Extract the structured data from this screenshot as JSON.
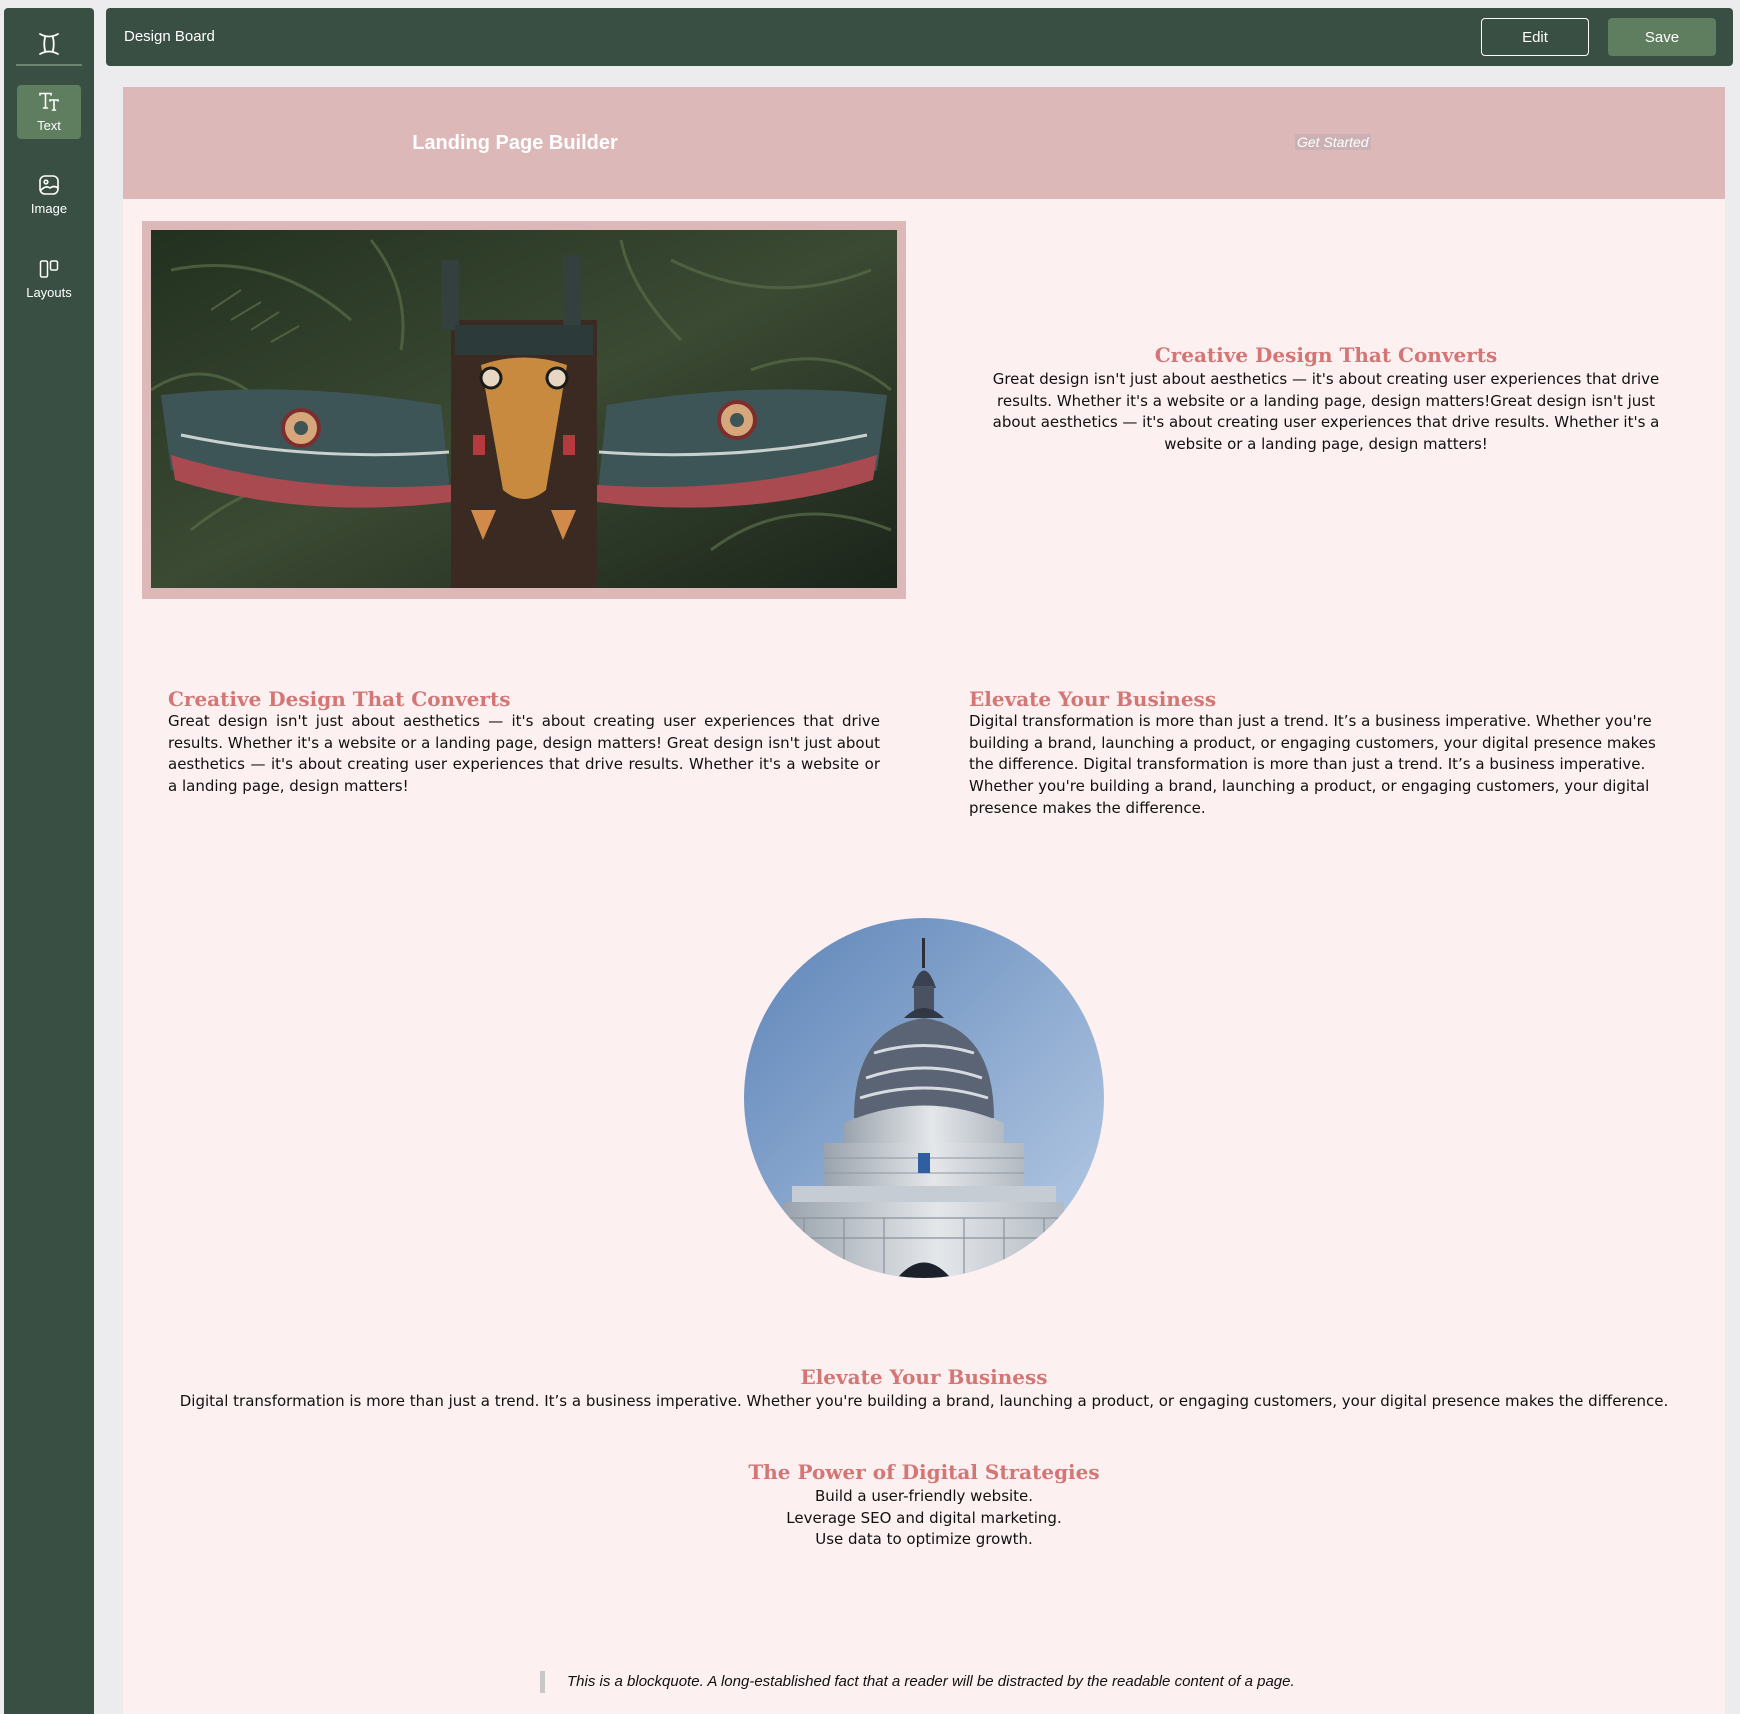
{
  "app": {
    "title": "Design Board"
  },
  "sidebar": {
    "logo_icon": "gemini-icon",
    "items": [
      {
        "label": "Text",
        "icon": "text-icon",
        "active": true
      },
      {
        "label": "Image",
        "icon": "image-icon",
        "active": false
      },
      {
        "label": "Layouts",
        "icon": "layouts-icon",
        "active": false
      }
    ]
  },
  "toolbar": {
    "edit_label": "Edit",
    "save_label": "Save"
  },
  "colors": {
    "sidebar": "#3a4f43",
    "accent_button": "#5f7d5f",
    "hero_bg": "#dcb8b8",
    "canvas_bg": "#fcf0f0",
    "heading": "#d47676"
  },
  "canvas": {
    "hero": {
      "title": "Landing Page Builder",
      "cta": "Get Started"
    },
    "section1": {
      "image": "totem-pole-photo",
      "heading": "Creative Design That Converts",
      "body": "Great design isn't just about aesthetics — it's about creating user experiences that drive results. Whether it's a website or a landing page, design matters!Great design isn't just about aesthetics — it's about creating user experiences that drive results. Whether it's a website or a landing page, design matters!"
    },
    "section2": {
      "left": {
        "heading": "Creative Design That Converts",
        "body": "Great design isn't just about aesthetics — it's about creating user experiences that drive results. Whether it's a website or a landing page, design matters! Great design isn't just about aesthetics — it's about creating user experiences that drive results. Whether it's a website or a landing page, design matters!"
      },
      "right": {
        "heading": "Elevate Your Business",
        "body": "Digital transformation is more than just a trend. It’s a business imperative. Whether you're building a brand, launching a product, or engaging customers, your digital presence makes the difference. Digital transformation is more than just a trend. It’s a business imperative. Whether you're building a brand, launching a product, or engaging customers, your digital presence makes the difference."
      }
    },
    "circle_image": "dome-building-photo",
    "section3": {
      "heading": "Elevate Your Business",
      "body": "Digital transformation is more than just a trend. It’s a business imperative. Whether you're building a brand, launching a product, or engaging customers, your digital presence makes the difference."
    },
    "section4": {
      "heading": "The Power of Digital Strategies",
      "lines": [
        "Build a user-friendly website.",
        "Leverage SEO and digital marketing.",
        "Use data to optimize growth."
      ]
    },
    "blockquote": "This is a blockquote. A long-established fact that a reader will be distracted by the readable content of a page."
  }
}
